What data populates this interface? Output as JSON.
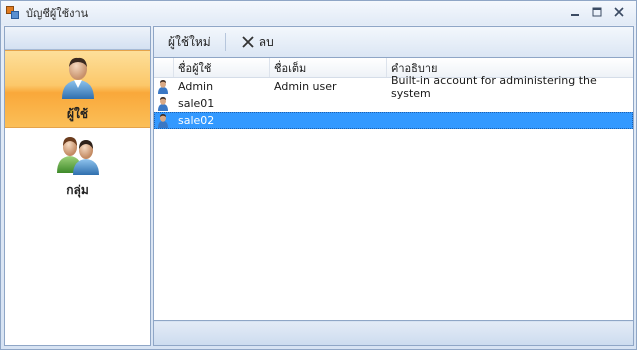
{
  "window": {
    "title": "บัญชีผู้ใช้งาน",
    "controls": [
      "minimize-icon",
      "maximize-icon",
      "close-icon"
    ]
  },
  "sidebar": {
    "items": [
      {
        "label": "ผู้ใช้",
        "icon": "user-icon",
        "active": true
      },
      {
        "label": "กลุ่ม",
        "icon": "group-icon",
        "active": false
      }
    ]
  },
  "toolbar": {
    "new_user_label": "ผู้ใช้ใหม่",
    "delete_label": "ลบ"
  },
  "table": {
    "columns": [
      "ชื่อผู้ใช้",
      "ชื่อเต็ม",
      "คำอธิบาย"
    ],
    "rows": [
      {
        "username": "Admin",
        "fullname": "Admin user",
        "description": "Built-in account for administering the system",
        "selected": false
      },
      {
        "username": "sale01",
        "fullname": "",
        "description": "",
        "selected": false
      },
      {
        "username": "sale02",
        "fullname": "",
        "description": "",
        "selected": true
      }
    ]
  },
  "colors": {
    "accent_active": "#fbbf58",
    "selection": "#3399ff",
    "frame": "#8fa6c6"
  }
}
